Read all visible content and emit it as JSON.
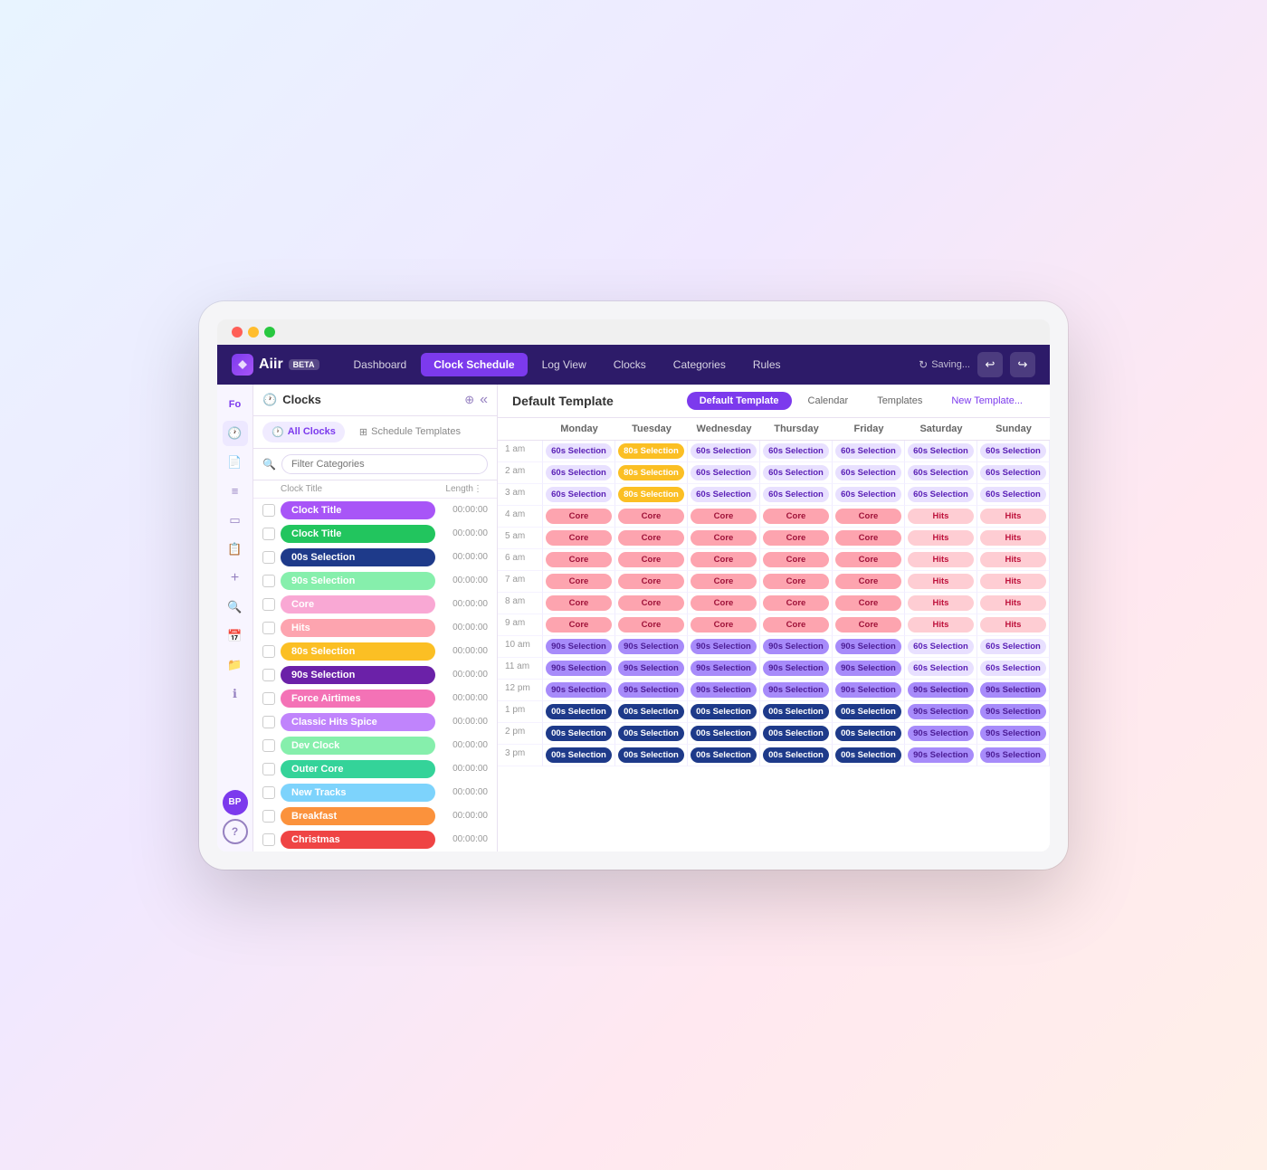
{
  "app": {
    "logo": "Aiir",
    "beta": "BETA",
    "saving": "Saving..."
  },
  "nav": {
    "links": [
      "Dashboard",
      "Clock Schedule",
      "Log View",
      "Clocks",
      "Categories",
      "Rules"
    ],
    "active": "Clock Schedule"
  },
  "clocks_panel": {
    "title": "Clocks",
    "all_clocks_label": "All Clocks",
    "schedule_templates_label": "Schedule Templates",
    "filter_placeholder": "Filter Categories",
    "col_title": "Clock Title",
    "col_length": "Length",
    "clocks": [
      {
        "name": "Clock Title",
        "color": "#a855f7",
        "time": "00:00:00"
      },
      {
        "name": "Clock Title",
        "color": "#22c55e",
        "time": "00:00:00"
      },
      {
        "name": "00s Selection",
        "color": "#1e3a8a",
        "time": "00:00:00"
      },
      {
        "name": "90s Selection",
        "color": "#86efac",
        "time": "00:00:00"
      },
      {
        "name": "Core",
        "color": "#f9a8d4",
        "time": "00:00:00"
      },
      {
        "name": "Hits",
        "color": "#fda4af",
        "time": "00:00:00"
      },
      {
        "name": "80s Selection",
        "color": "#fbbf24",
        "time": "00:00:00"
      },
      {
        "name": "90s Selection",
        "color": "#6b21a8",
        "time": "00:00:00"
      },
      {
        "name": "Force Airtimes",
        "color": "#f472b6",
        "time": "00:00:00"
      },
      {
        "name": "Classic Hits Spice",
        "color": "#c084fc",
        "time": "00:00:00"
      },
      {
        "name": "Dev Clock",
        "color": "#86efac",
        "time": "00:00:00"
      },
      {
        "name": "Outer Core",
        "color": "#34d399",
        "time": "00:00:00"
      },
      {
        "name": "New Tracks",
        "color": "#7dd3fc",
        "time": "00:00:00"
      },
      {
        "name": "Breakfast",
        "color": "#fb923c",
        "time": "00:00:00"
      },
      {
        "name": "Christmas",
        "color": "#ef4444",
        "time": "00:00:00"
      }
    ]
  },
  "schedule": {
    "title": "Default Template",
    "tabs": [
      "Default Template",
      "Calendar",
      "Templates",
      "New Template..."
    ],
    "active_tab": "Default Template",
    "days": [
      "Monday",
      "Tuesday",
      "Wednesday",
      "Thursday",
      "Friday",
      "Saturday",
      "Sunday"
    ],
    "hours": [
      "1 am",
      "2 am",
      "3 am",
      "4 am",
      "5 am",
      "6 am",
      "7 am",
      "8 am",
      "9 am",
      "10 am",
      "11 am",
      "12 pm",
      "1 pm",
      "2 pm",
      "3 pm"
    ],
    "grid": [
      [
        "60s Selection",
        "80s Selection",
        "60s Selection",
        "60s Selection",
        "60s Selection",
        "60s Selection",
        "60s Selection"
      ],
      [
        "60s Selection",
        "80s Selection",
        "60s Selection",
        "60s Selection",
        "60s Selection",
        "60s Selection",
        "60s Selection"
      ],
      [
        "60s Selection",
        "80s Selection",
        "60s Selection",
        "60s Selection",
        "60s Selection",
        "60s Selection",
        "60s Selection"
      ],
      [
        "Core",
        "Core",
        "Core",
        "Core",
        "Core",
        "Hits",
        "Hits"
      ],
      [
        "Core",
        "Core",
        "Core",
        "Core",
        "Core",
        "Hits",
        "Hits"
      ],
      [
        "Core",
        "Core",
        "Core",
        "Core",
        "Core",
        "Hits",
        "Hits"
      ],
      [
        "Core",
        "Core",
        "Core",
        "Core",
        "Core",
        "Hits",
        "Hits"
      ],
      [
        "Core",
        "Core",
        "Core",
        "Core",
        "Core",
        "Hits",
        "Hits"
      ],
      [
        "Core",
        "Core",
        "Core",
        "Core",
        "Core",
        "Hits",
        "Hits"
      ],
      [
        "90s Selection",
        "90s Selection",
        "90s Selection",
        "90s Selection",
        "90s Selection",
        "60s Selection",
        "60s Selection"
      ],
      [
        "90s Selection",
        "90s Selection",
        "90s Selection",
        "90s Selection",
        "90s Selection",
        "60s Selection",
        "60s Selection"
      ],
      [
        "90s Selection",
        "90s Selection",
        "90s Selection",
        "90s Selection",
        "90s Selection",
        "90s Selection",
        "90s Selection"
      ],
      [
        "00s Selection",
        "00s Selection",
        "00s Selection",
        "00s Selection",
        "00s Selection",
        "90s Selection",
        "90s Selection"
      ],
      [
        "00s Selection",
        "00s Selection",
        "00s Selection",
        "00s Selection",
        "00s Selection",
        "90s Selection",
        "90s Selection"
      ],
      [
        "00s Selection",
        "00s Selection",
        "00s Selection",
        "00s Selection",
        "00s Selection",
        "90s Selection",
        "90s Selection"
      ]
    ]
  },
  "sidebar": {
    "icons": [
      "☰",
      "📄",
      "≡",
      "▭",
      "📋",
      "+",
      "🔍",
      "📅",
      "📁",
      "ℹ"
    ],
    "avatar": "BP",
    "help": "?"
  }
}
